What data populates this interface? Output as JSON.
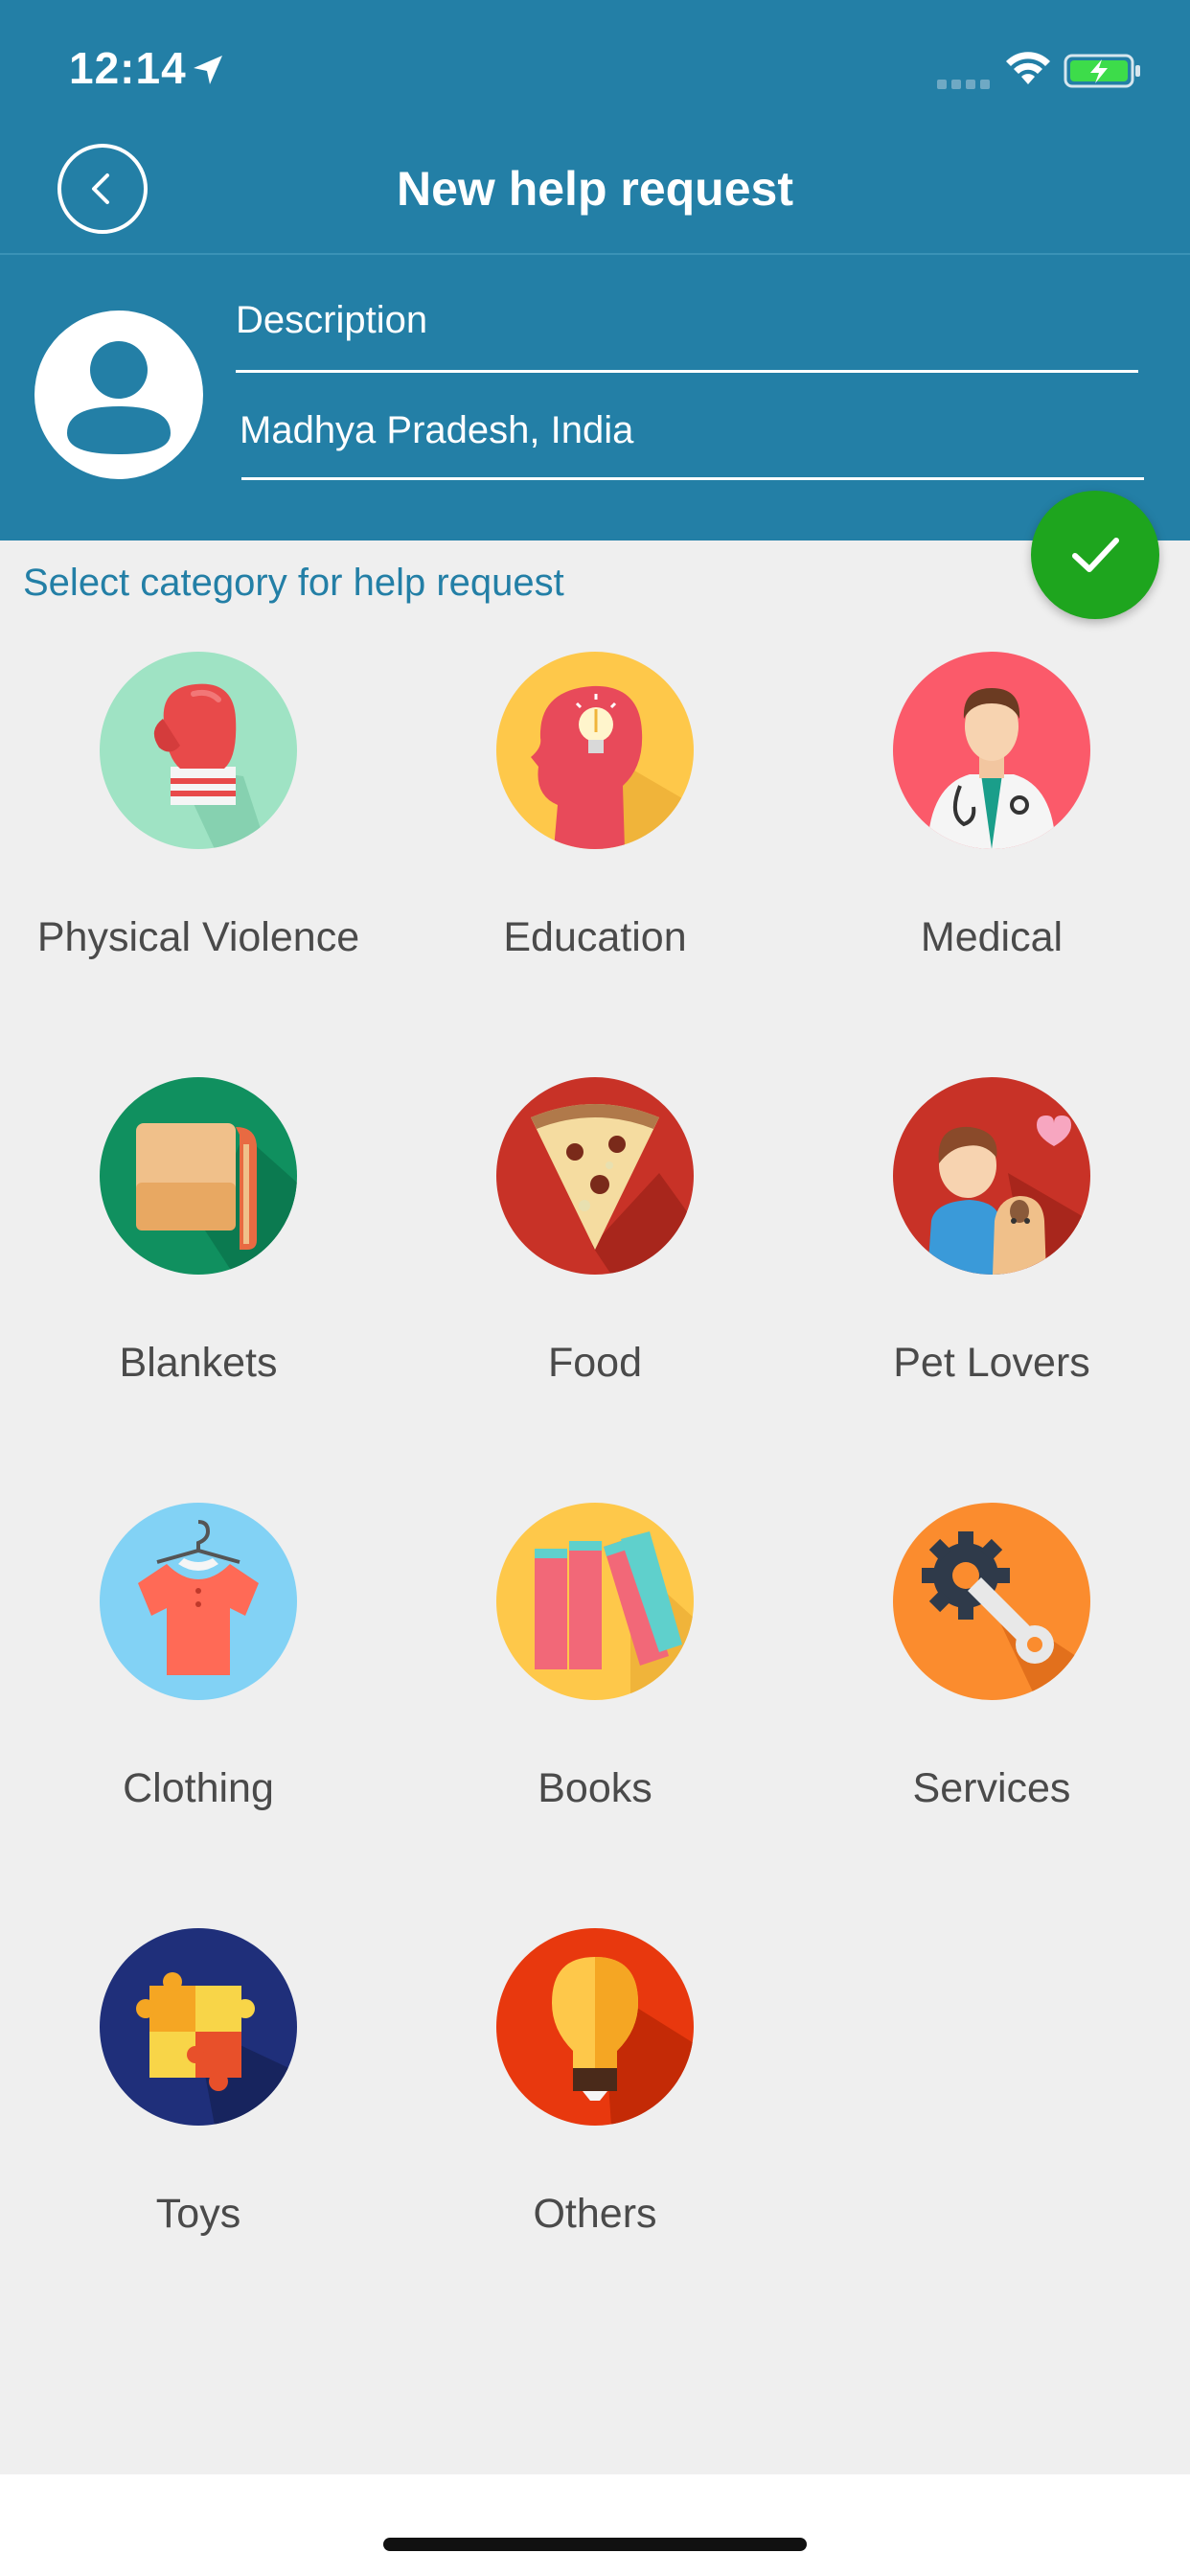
{
  "status_bar": {
    "time": "12:14",
    "icons": [
      "location-arrow-icon",
      "cellular-signal-icon",
      "wifi-icon",
      "battery-charging-icon"
    ]
  },
  "nav": {
    "title": "New help request",
    "back_icon": "chevron-left-icon"
  },
  "form": {
    "description_label": "Description",
    "location_value": "Madhya Pradesh, India",
    "avatar_icon": "user-avatar-icon",
    "submit_icon": "checkmark-icon"
  },
  "section_title": "Select category for help request",
  "categories": [
    {
      "label": "Physical Violence",
      "icon": "boxing-glove-icon",
      "color": "#9fe3c4"
    },
    {
      "label": "Education",
      "icon": "head-lightbulb-icon",
      "color": "#fec84a"
    },
    {
      "label": "Medical",
      "icon": "doctor-icon",
      "color": "#fb5a6a"
    },
    {
      "label": "Blankets",
      "icon": "blanket-icon",
      "color": "#10905f"
    },
    {
      "label": "Food",
      "icon": "pizza-slice-icon",
      "color": "#c83227"
    },
    {
      "label": "Pet Lovers",
      "icon": "person-with-dog-icon",
      "color": "#c83227"
    },
    {
      "label": "Clothing",
      "icon": "shirt-on-hanger-icon",
      "color": "#82d2f5"
    },
    {
      "label": "Books",
      "icon": "books-icon",
      "color": "#fec84a"
    },
    {
      "label": "Services",
      "icon": "gear-wrench-icon",
      "color": "#fb8c2e"
    },
    {
      "label": "Toys",
      "icon": "puzzle-pieces-icon",
      "color": "#1f2f7a"
    },
    {
      "label": "Others",
      "icon": "lightbulb-icon",
      "color": "#e8380e"
    }
  ],
  "colors": {
    "header": "#237fa6",
    "accent_text": "#237fa6",
    "submit": "#1ea51e",
    "background": "#efefef"
  }
}
